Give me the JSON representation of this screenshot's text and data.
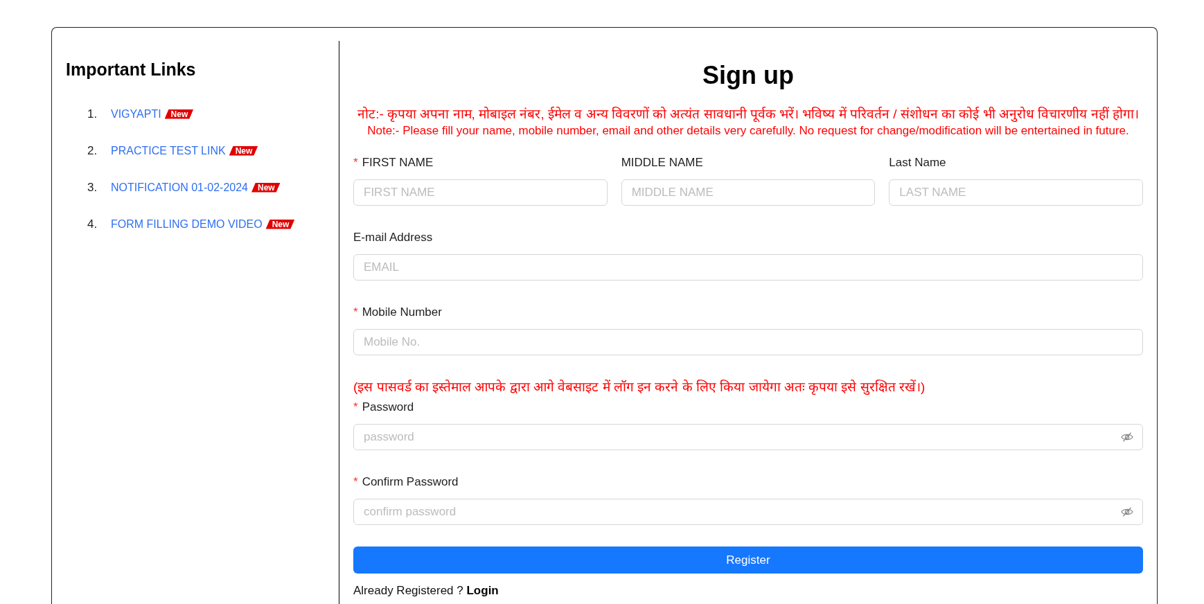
{
  "sidebar": {
    "title": "Important Links",
    "links": [
      {
        "number": "1.",
        "label": "VIGYAPTI",
        "badge": "New"
      },
      {
        "number": "2.",
        "label": "PRACTICE TEST LINK",
        "badge": "New"
      },
      {
        "number": "3.",
        "label": "NOTIFICATION 01-02-2024",
        "badge": "New"
      },
      {
        "number": "4.",
        "label": "FORM FILLING DEMO VIDEO",
        "badge": "New"
      }
    ]
  },
  "form": {
    "title": "Sign up",
    "notes": [
      "नोट:- कृपया अपना नाम, मोबाइल नंबर, ईमेल व अन्य विवरणों को अत्यंत सावधानी पूर्वक भरें। भविष्य में परिवर्तन / संशोधन का कोई भी अनुरोध विचारणीय नहीं होगा।",
      "Note:- Please fill your name, mobile number, email and other details very carefully. No request for change/modification will be entertained in future."
    ],
    "rows": [
      {
        "fields": [
          {
            "required_mark": "*",
            "label": "FIRST NAME",
            "placeholder": "FIRST NAME",
            "kind": "text"
          },
          {
            "label": "MIDDLE NAME",
            "placeholder": "MIDDLE NAME",
            "kind": "text"
          },
          {
            "label": "Last Name",
            "placeholder": "LAST NAME",
            "kind": "text"
          }
        ]
      },
      {
        "fields": [
          {
            "label": "E-mail Address",
            "placeholder": "EMAIL",
            "kind": "text"
          }
        ]
      },
      {
        "fields": [
          {
            "required_mark": "*",
            "label": "Mobile Number",
            "placeholder": "Mobile No.",
            "kind": "text"
          }
        ]
      },
      {
        "notice": "(इस पासवर्ड का इस्तेमाल आपके द्वारा आगे वेबसाइट में लॉग इन करने के लिए किया जायेगा अतः कृपया इसे सुरक्षित रखें।)",
        "fields": [
          {
            "required_mark": "*",
            "label": "Password",
            "placeholder": "password",
            "kind": "password"
          }
        ]
      },
      {
        "fields": [
          {
            "required_mark": "*",
            "label": "Confirm Password",
            "placeholder": "confirm password",
            "kind": "password"
          }
        ]
      }
    ],
    "submit": {
      "label": "Register"
    },
    "footer": {
      "text": "Already Registered ?",
      "link": "Login"
    }
  }
}
